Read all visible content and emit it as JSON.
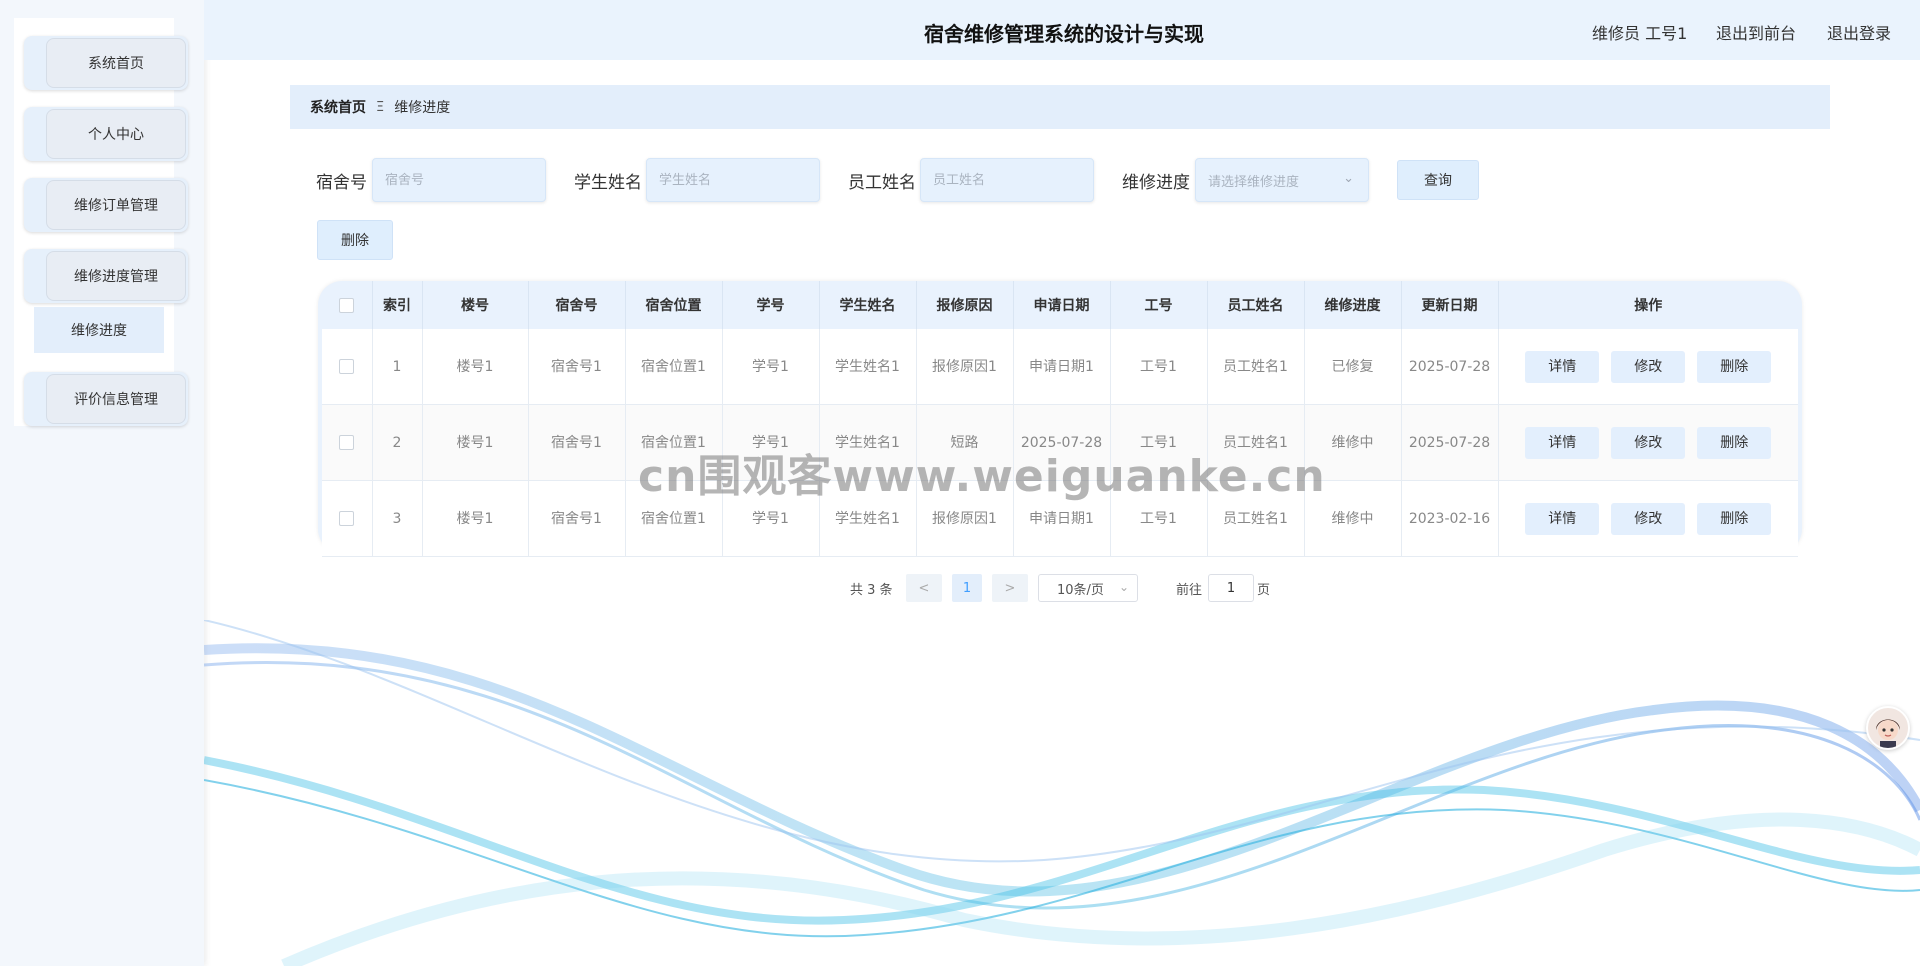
{
  "header": {
    "title": "宿舍维修管理系统的设计与实现",
    "user": "维修员 工号1",
    "back_to_front": "退出到前台",
    "logout": "退出登录"
  },
  "sidebar": {
    "items": [
      {
        "label": "系统首页"
      },
      {
        "label": "个人中心"
      },
      {
        "label": "维修订单管理"
      },
      {
        "label": "维修进度管理"
      },
      {
        "label": "评价信息管理"
      }
    ],
    "submenu_label": "维修进度"
  },
  "breadcrumb": {
    "home": "系统首页",
    "separator": "Ξ",
    "current": "维修进度"
  },
  "filters": {
    "dorm_label": "宿舍号",
    "dorm_placeholder": "宿舍号",
    "student_label": "学生姓名",
    "student_placeholder": "学生姓名",
    "employee_label": "员工姓名",
    "employee_placeholder": "员工姓名",
    "progress_label": "维修进度",
    "progress_placeholder": "请选择维修进度",
    "search_button": "查询",
    "delete_button": "删除"
  },
  "table": {
    "headers": [
      "",
      "索引",
      "楼号",
      "宿舍号",
      "宿舍位置",
      "学号",
      "学生姓名",
      "报修原因",
      "申请日期",
      "工号",
      "员工姓名",
      "维修进度",
      "更新日期",
      "操作"
    ],
    "rows": [
      {
        "index": "1",
        "building": "楼号1",
        "dorm": "宿舍号1",
        "location": "宿舍位置1",
        "student_id": "学号1",
        "student_name": "学生姓名1",
        "reason": "报修原因1",
        "apply_date": "申请日期1",
        "emp_id": "工号1",
        "emp_name": "员工姓名1",
        "progress": "已修复",
        "update_date": "2025-07-28"
      },
      {
        "index": "2",
        "building": "楼号1",
        "dorm": "宿舍号1",
        "location": "宿舍位置1",
        "student_id": "学号1",
        "student_name": "学生姓名1",
        "reason": "短路",
        "apply_date": "2025-07-28",
        "emp_id": "工号1",
        "emp_name": "员工姓名1",
        "progress": "维修中",
        "update_date": "2025-07-28"
      },
      {
        "index": "3",
        "building": "楼号1",
        "dorm": "宿舍号1",
        "location": "宿舍位置1",
        "student_id": "学号1",
        "student_name": "学生姓名1",
        "reason": "报修原因1",
        "apply_date": "申请日期1",
        "emp_id": "工号1",
        "emp_name": "员工姓名1",
        "progress": "维修中",
        "update_date": "2023-02-16"
      }
    ],
    "actions": {
      "detail": "详情",
      "edit": "修改",
      "delete": "删除"
    }
  },
  "pagination": {
    "total": "共 3 条",
    "prev": "<",
    "current_page": "1",
    "next": ">",
    "page_size": "10条/页",
    "goto_label": "前往",
    "goto_value": "1",
    "page_unit": "页"
  },
  "watermark": "cn围观客www.weiguanke.cn",
  "icons": {
    "dropdown": "chevron-down-icon",
    "assistant": "assistant-avatar-icon"
  },
  "colors": {
    "header_bg": "#eaf3fd",
    "accent_light": "#e3eefb",
    "button_bg": "#dfeefd"
  }
}
